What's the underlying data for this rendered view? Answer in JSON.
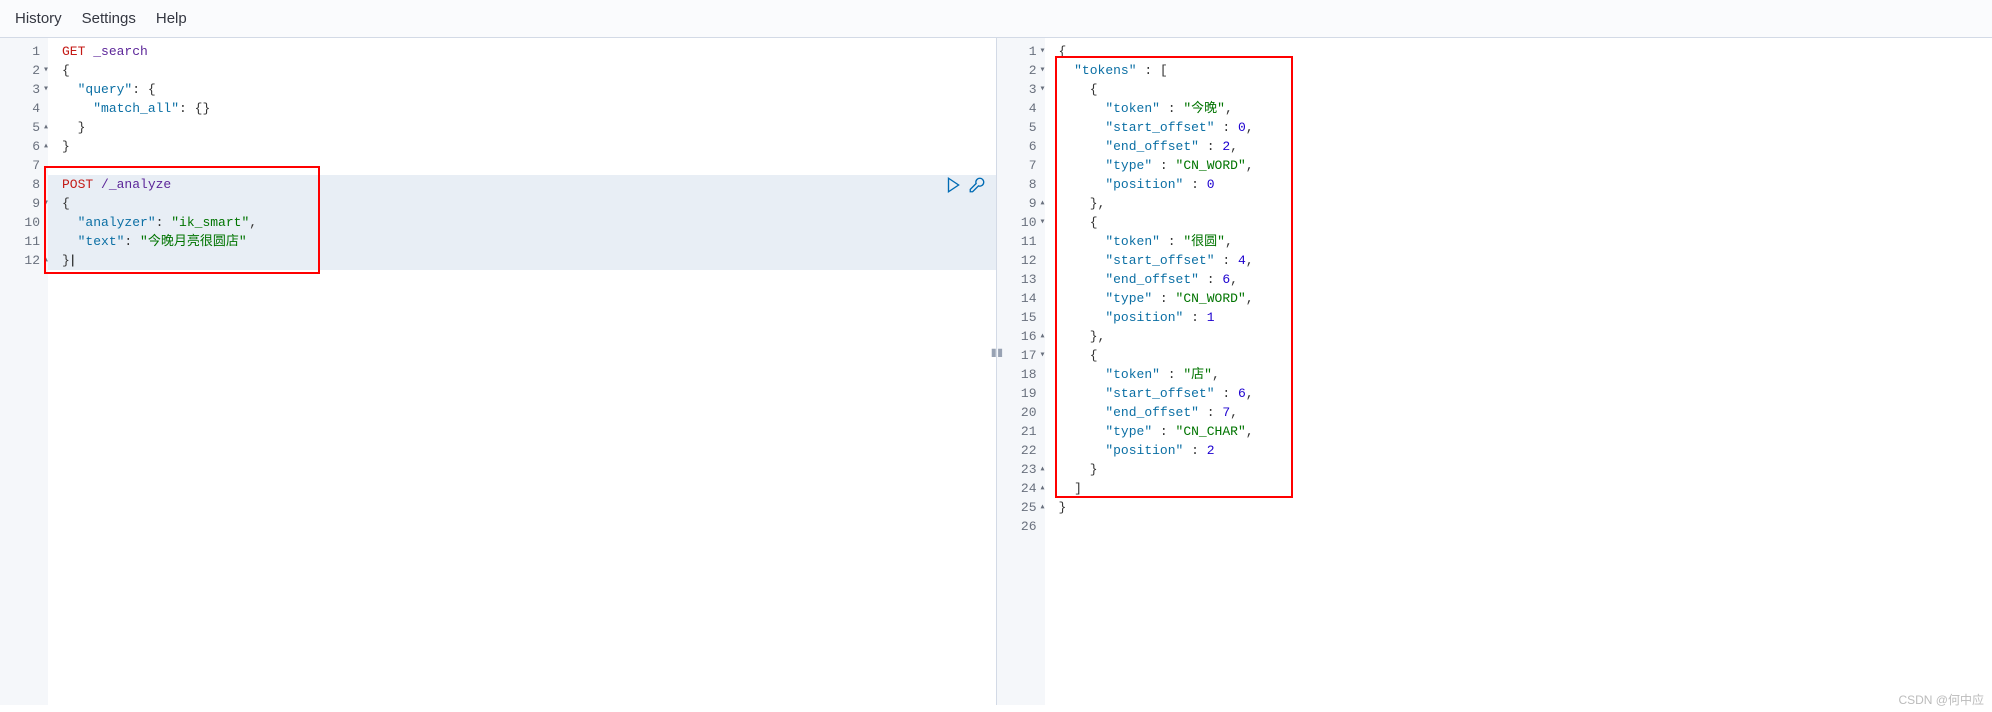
{
  "menu": {
    "history": "History",
    "settings": "Settings",
    "help": "Help"
  },
  "left_editor": {
    "lines": [
      {
        "n": "1",
        "fold": "",
        "tokens": [
          {
            "t": "GET ",
            "c": "method"
          },
          {
            "t": "_search",
            "c": "path"
          }
        ]
      },
      {
        "n": "2",
        "fold": "▾",
        "tokens": [
          {
            "t": "{",
            "c": "brace"
          }
        ]
      },
      {
        "n": "3",
        "fold": "▾",
        "tokens": [
          {
            "t": "  ",
            "c": ""
          },
          {
            "t": "\"query\"",
            "c": "key"
          },
          {
            "t": ": {",
            "c": "punct"
          }
        ]
      },
      {
        "n": "4",
        "fold": "",
        "tokens": [
          {
            "t": "    ",
            "c": ""
          },
          {
            "t": "\"match_all\"",
            "c": "key"
          },
          {
            "t": ": {}",
            "c": "punct"
          }
        ]
      },
      {
        "n": "5",
        "fold": "▴",
        "tokens": [
          {
            "t": "  }",
            "c": "brace"
          }
        ]
      },
      {
        "n": "6",
        "fold": "▴",
        "tokens": [
          {
            "t": "}",
            "c": "brace"
          }
        ]
      },
      {
        "n": "7",
        "fold": "",
        "tokens": []
      },
      {
        "n": "8",
        "fold": "",
        "tokens": [
          {
            "t": "POST ",
            "c": "method"
          },
          {
            "t": "/_analyze",
            "c": "path"
          }
        ]
      },
      {
        "n": "9",
        "fold": "▾",
        "tokens": [
          {
            "t": "{",
            "c": "brace"
          }
        ]
      },
      {
        "n": "10",
        "fold": "",
        "tokens": [
          {
            "t": "  ",
            "c": ""
          },
          {
            "t": "\"analyzer\"",
            "c": "key"
          },
          {
            "t": ": ",
            "c": "punct"
          },
          {
            "t": "\"ik_smart\"",
            "c": "string"
          },
          {
            "t": ",",
            "c": "punct"
          }
        ]
      },
      {
        "n": "11",
        "fold": "",
        "tokens": [
          {
            "t": "  ",
            "c": ""
          },
          {
            "t": "\"text\"",
            "c": "key"
          },
          {
            "t": ": ",
            "c": "punct"
          },
          {
            "t": "\"今晚月亮很圆店\"",
            "c": "string"
          }
        ]
      },
      {
        "n": "12",
        "fold": "▴",
        "tokens": [
          {
            "t": "}",
            "c": "brace cursor-mark"
          }
        ]
      }
    ]
  },
  "right_editor": {
    "lines": [
      {
        "n": "1",
        "fold": "▾",
        "tokens": [
          {
            "t": "{",
            "c": "brace"
          }
        ]
      },
      {
        "n": "2",
        "fold": "▾",
        "tokens": [
          {
            "t": "  ",
            "c": ""
          },
          {
            "t": "\"tokens\"",
            "c": "key"
          },
          {
            "t": " : [",
            "c": "punct"
          }
        ]
      },
      {
        "n": "3",
        "fold": "▾",
        "tokens": [
          {
            "t": "    {",
            "c": "brace"
          }
        ]
      },
      {
        "n": "4",
        "fold": "",
        "tokens": [
          {
            "t": "      ",
            "c": ""
          },
          {
            "t": "\"token\"",
            "c": "key"
          },
          {
            "t": " : ",
            "c": "punct"
          },
          {
            "t": "\"今晚\"",
            "c": "string"
          },
          {
            "t": ",",
            "c": "punct"
          }
        ]
      },
      {
        "n": "5",
        "fold": "",
        "tokens": [
          {
            "t": "      ",
            "c": ""
          },
          {
            "t": "\"start_offset\"",
            "c": "key"
          },
          {
            "t": " : ",
            "c": "punct"
          },
          {
            "t": "0",
            "c": "number"
          },
          {
            "t": ",",
            "c": "punct"
          }
        ]
      },
      {
        "n": "6",
        "fold": "",
        "tokens": [
          {
            "t": "      ",
            "c": ""
          },
          {
            "t": "\"end_offset\"",
            "c": "key"
          },
          {
            "t": " : ",
            "c": "punct"
          },
          {
            "t": "2",
            "c": "number"
          },
          {
            "t": ",",
            "c": "punct"
          }
        ]
      },
      {
        "n": "7",
        "fold": "",
        "tokens": [
          {
            "t": "      ",
            "c": ""
          },
          {
            "t": "\"type\"",
            "c": "key"
          },
          {
            "t": " : ",
            "c": "punct"
          },
          {
            "t": "\"CN_WORD\"",
            "c": "string"
          },
          {
            "t": ",",
            "c": "punct"
          }
        ]
      },
      {
        "n": "8",
        "fold": "",
        "tokens": [
          {
            "t": "      ",
            "c": ""
          },
          {
            "t": "\"position\"",
            "c": "key"
          },
          {
            "t": " : ",
            "c": "punct"
          },
          {
            "t": "0",
            "c": "number"
          }
        ]
      },
      {
        "n": "9",
        "fold": "▴",
        "tokens": [
          {
            "t": "    },",
            "c": "brace"
          }
        ]
      },
      {
        "n": "10",
        "fold": "▾",
        "tokens": [
          {
            "t": "    {",
            "c": "brace"
          }
        ]
      },
      {
        "n": "11",
        "fold": "",
        "tokens": [
          {
            "t": "      ",
            "c": ""
          },
          {
            "t": "\"token\"",
            "c": "key"
          },
          {
            "t": " : ",
            "c": "punct"
          },
          {
            "t": "\"很圆\"",
            "c": "string"
          },
          {
            "t": ",",
            "c": "punct"
          }
        ]
      },
      {
        "n": "12",
        "fold": "",
        "tokens": [
          {
            "t": "      ",
            "c": ""
          },
          {
            "t": "\"start_offset\"",
            "c": "key"
          },
          {
            "t": " : ",
            "c": "punct"
          },
          {
            "t": "4",
            "c": "number"
          },
          {
            "t": ",",
            "c": "punct"
          }
        ]
      },
      {
        "n": "13",
        "fold": "",
        "tokens": [
          {
            "t": "      ",
            "c": ""
          },
          {
            "t": "\"end_offset\"",
            "c": "key"
          },
          {
            "t": " : ",
            "c": "punct"
          },
          {
            "t": "6",
            "c": "number"
          },
          {
            "t": ",",
            "c": "punct"
          }
        ]
      },
      {
        "n": "14",
        "fold": "",
        "tokens": [
          {
            "t": "      ",
            "c": ""
          },
          {
            "t": "\"type\"",
            "c": "key"
          },
          {
            "t": " : ",
            "c": "punct"
          },
          {
            "t": "\"CN_WORD\"",
            "c": "string"
          },
          {
            "t": ",",
            "c": "punct"
          }
        ]
      },
      {
        "n": "15",
        "fold": "",
        "tokens": [
          {
            "t": "      ",
            "c": ""
          },
          {
            "t": "\"position\"",
            "c": "key"
          },
          {
            "t": " : ",
            "c": "punct"
          },
          {
            "t": "1",
            "c": "number"
          }
        ]
      },
      {
        "n": "16",
        "fold": "▴",
        "tokens": [
          {
            "t": "    },",
            "c": "brace"
          }
        ]
      },
      {
        "n": "17",
        "fold": "▾",
        "tokens": [
          {
            "t": "    {",
            "c": "brace"
          }
        ]
      },
      {
        "n": "18",
        "fold": "",
        "tokens": [
          {
            "t": "      ",
            "c": ""
          },
          {
            "t": "\"token\"",
            "c": "key"
          },
          {
            "t": " : ",
            "c": "punct"
          },
          {
            "t": "\"店\"",
            "c": "string"
          },
          {
            "t": ",",
            "c": "punct"
          }
        ]
      },
      {
        "n": "19",
        "fold": "",
        "tokens": [
          {
            "t": "      ",
            "c": ""
          },
          {
            "t": "\"start_offset\"",
            "c": "key"
          },
          {
            "t": " : ",
            "c": "punct"
          },
          {
            "t": "6",
            "c": "number"
          },
          {
            "t": ",",
            "c": "punct"
          }
        ]
      },
      {
        "n": "20",
        "fold": "",
        "tokens": [
          {
            "t": "      ",
            "c": ""
          },
          {
            "t": "\"end_offset\"",
            "c": "key"
          },
          {
            "t": " : ",
            "c": "punct"
          },
          {
            "t": "7",
            "c": "number"
          },
          {
            "t": ",",
            "c": "punct"
          }
        ]
      },
      {
        "n": "21",
        "fold": "",
        "tokens": [
          {
            "t": "      ",
            "c": ""
          },
          {
            "t": "\"type\"",
            "c": "key"
          },
          {
            "t": " : ",
            "c": "punct"
          },
          {
            "t": "\"CN_CHAR\"",
            "c": "string"
          },
          {
            "t": ",",
            "c": "punct"
          }
        ]
      },
      {
        "n": "22",
        "fold": "",
        "tokens": [
          {
            "t": "      ",
            "c": ""
          },
          {
            "t": "\"position\"",
            "c": "key"
          },
          {
            "t": " : ",
            "c": "punct"
          },
          {
            "t": "2",
            "c": "number"
          }
        ]
      },
      {
        "n": "23",
        "fold": "▴",
        "tokens": [
          {
            "t": "    }",
            "c": "brace"
          }
        ]
      },
      {
        "n": "24",
        "fold": "▴",
        "tokens": [
          {
            "t": "  ]",
            "c": "brace"
          }
        ]
      },
      {
        "n": "25",
        "fold": "▴",
        "tokens": [
          {
            "t": "}",
            "c": "brace"
          }
        ]
      },
      {
        "n": "26",
        "fold": "",
        "tokens": []
      }
    ]
  },
  "watermark": "CSDN @何中应"
}
